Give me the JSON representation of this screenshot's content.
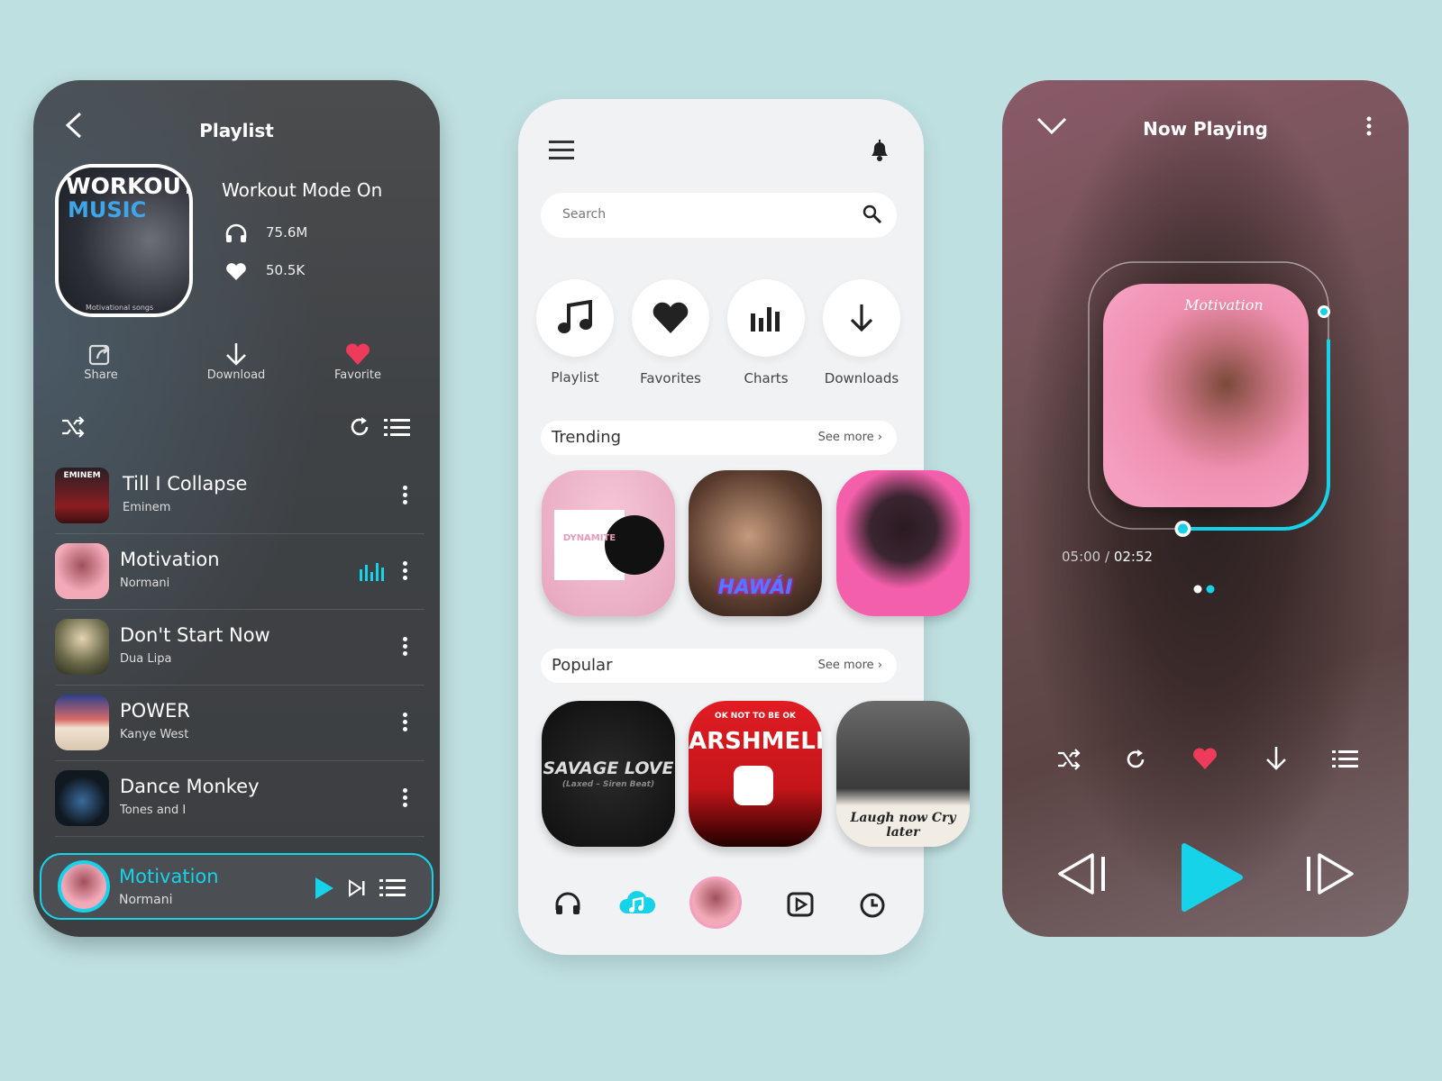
{
  "playlist_screen": {
    "title": "Playlist",
    "cover_text": {
      "line1": "WORKOUT",
      "line2": "MUSIC",
      "caption": "Motivational songs"
    },
    "playlist_name": "Workout Mode On",
    "listens": "75.6M",
    "likes": "50.5K",
    "actions": [
      {
        "label": "Share",
        "icon": "share-icon"
      },
      {
        "label": "Download",
        "icon": "download-icon"
      },
      {
        "label": "Favorite",
        "icon": "heart-icon"
      }
    ],
    "songs": [
      {
        "title": "Till I Collapse",
        "artist": "Eminem",
        "art_text": "EMINEM",
        "playing": false
      },
      {
        "title": "Motivation",
        "artist": "Normani",
        "playing": true
      },
      {
        "title": "Don't Start Now",
        "artist": "Dua Lipa",
        "playing": false
      },
      {
        "title": "POWER",
        "artist": "Kanye West",
        "playing": false
      },
      {
        "title": "Dance Monkey",
        "artist": "Tones and I",
        "playing": false
      }
    ],
    "mini_player": {
      "title": "Motivation",
      "artist": "Normani"
    }
  },
  "home_screen": {
    "search_placeholder": "Search",
    "categories": [
      {
        "label": "Playlist",
        "icon": "music-note-icon"
      },
      {
        "label": "Favorites",
        "icon": "heart-icon"
      },
      {
        "label": "Charts",
        "icon": "bar-chart-icon"
      },
      {
        "label": "Downloads",
        "icon": "download-icon"
      }
    ],
    "trending": {
      "title": "Trending",
      "see_more": "See more",
      "albums": [
        {
          "text": "DYNAMITE"
        },
        {
          "text": "HAWÁI"
        },
        {
          "text": ""
        }
      ]
    },
    "popular": {
      "title": "Popular",
      "see_more": "See more",
      "albums": [
        {
          "text": "SAVAGE LOVE",
          "sub": "(Laxed – Siren Beat)"
        },
        {
          "text": "ARSHMELL",
          "sub": "OK NOT TO BE OK"
        },
        {
          "text": "Laugh now Cry later"
        }
      ]
    },
    "bottom_nav": [
      "headphones-icon",
      "cloud-music-icon",
      "avatar",
      "play-square-icon",
      "clock-icon"
    ],
    "accent": "#16d3ea"
  },
  "now_playing": {
    "title": "Now Playing",
    "album_text": "Motivation",
    "elapsed": "05:00",
    "duration": "02:52",
    "progress": 0.75,
    "page_index": 2,
    "page_count": 2
  }
}
